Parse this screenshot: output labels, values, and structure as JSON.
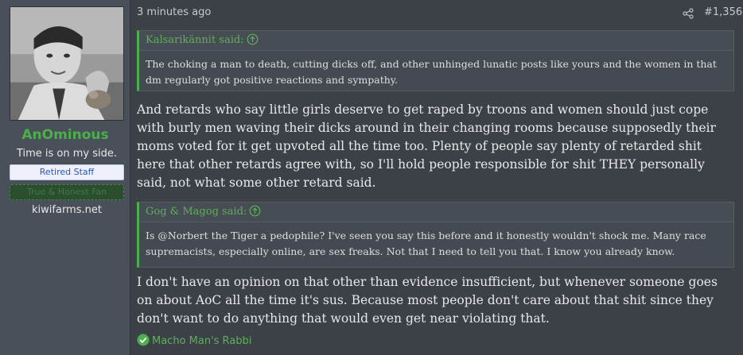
{
  "user": {
    "name": "AnOminous",
    "title": "Time is on my side.",
    "banner_staff": "Retired Staff",
    "banner_green": "True & Honest Fan",
    "site": "kiwifarms.net"
  },
  "post": {
    "timestamp": "3 minutes ago",
    "number": "#1,356",
    "quotes": [
      {
        "author_line": "Kalsarikännit said:",
        "text": "The choking a man to death, cutting dicks off, and other unhinged lunatic posts like yours and the women in that dm regularly got positive reactions and sympathy."
      },
      {
        "author_line": "Gog & Magog said:",
        "text": "Is @Norbert the Tiger a pedophile? I've seen you say this before and it honestly wouldn't shock me. Many race supremacists, especially online, are sex freaks. Not that I need to tell you that. I know you already know."
      }
    ],
    "paragraphs": [
      "And retards who say little girls deserve to get raped by troons and women should just cope with burly men waving their dicks around in their changing rooms because supposedly their moms voted for it get upvoted all the time too. Plenty of people say plenty of retarded shit here that other retards agree with, so I'll hold people responsible for shit THEY personally said, not what some other retard said.",
      "I don't have an opinion on that other than evidence insufficient, but whenever someone goes on about AoC all the time it's sus. Because most people don't care about that shit since they don't want to do anything that would even get near violating that."
    ],
    "reaction": "Macho Man's Rabbi"
  },
  "icons": {
    "share": "share-icon",
    "quote_jump": "arrow-up-circle-icon",
    "reaction": "check-circle-icon"
  },
  "colors": {
    "accent_green": "#4cae4c",
    "background": "#3c4148",
    "sidebar": "#4a5059"
  }
}
